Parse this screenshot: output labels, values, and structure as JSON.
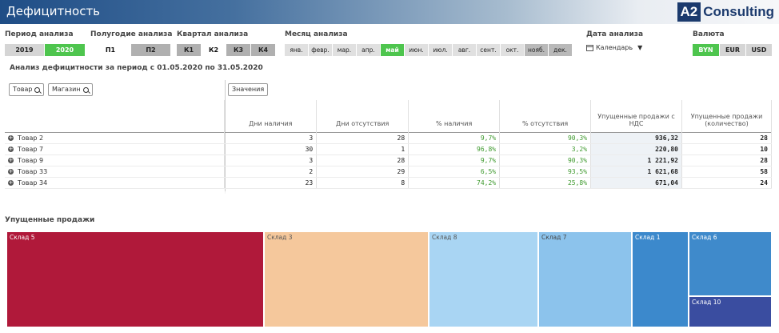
{
  "header": {
    "title": "Дефицитность",
    "logo_mark": "A2",
    "logo_text": "Consulting"
  },
  "filters": {
    "period": {
      "label": "Период анализа",
      "options": [
        "2019",
        "2020"
      ]
    },
    "half": {
      "label": "Полугодие анализа",
      "options": [
        "П1",
        "П2"
      ]
    },
    "quarter": {
      "label": "Квартал анализа",
      "options": [
        "К1",
        "К2",
        "К3",
        "К4"
      ]
    },
    "month": {
      "label": "Месяц анализа",
      "options": [
        "янв.",
        "февр.",
        "мар.",
        "апр.",
        "май",
        "июн.",
        "июл.",
        "авг.",
        "сент.",
        "окт.",
        "нояб.",
        "дек."
      ]
    },
    "date": {
      "label": "Дата анализа",
      "calendar": "Календарь"
    },
    "currency": {
      "label": "Валюта",
      "options": [
        "BYN",
        "EUR",
        "USD"
      ]
    }
  },
  "table_title": "Анализ дефицитности за период с 01.05.2020 по 31.05.2020",
  "dims": {
    "product": "Товар",
    "store": "Магазин",
    "values": "Значения"
  },
  "table": {
    "headers": [
      "Дни наличия",
      "Дни отсутствия",
      "% наличия",
      "% отсутствия",
      "Упущенные продажи с НДС",
      "Упущенные продажи (количество)"
    ],
    "rows": [
      {
        "name": "Товар 2",
        "cells": [
          "3",
          "28",
          "9,7%",
          "90,3%",
          "936,32",
          "28"
        ]
      },
      {
        "name": "Товар 7",
        "cells": [
          "30",
          "1",
          "96,8%",
          "3,2%",
          "220,80",
          "10"
        ]
      },
      {
        "name": "Товар 9",
        "cells": [
          "3",
          "28",
          "9,7%",
          "90,3%",
          "1 221,92",
          "28"
        ]
      },
      {
        "name": "Товар 33",
        "cells": [
          "2",
          "29",
          "6,5%",
          "93,5%",
          "1 621,68",
          "58"
        ]
      },
      {
        "name": "Товар 34",
        "cells": [
          "23",
          "8",
          "74,2%",
          "25,8%",
          "671,04",
          "24"
        ]
      }
    ]
  },
  "treemap": {
    "label": "Упущенные продажи",
    "colors": {
      "sklad5": "#b0193a",
      "sklad3": "#f5c89c",
      "sklad8": "#a9d5f3",
      "sklad7": "#8cc3ec",
      "sklad1": "#3c89cc",
      "sklad6": "#3f8acb",
      "sklad10": "#3a4da0"
    },
    "tiles": [
      "Склад 5",
      "Склад 3",
      "Склад 8",
      "Склад 7",
      "Склад 1",
      "Склад 6",
      "Склад 10"
    ]
  }
}
